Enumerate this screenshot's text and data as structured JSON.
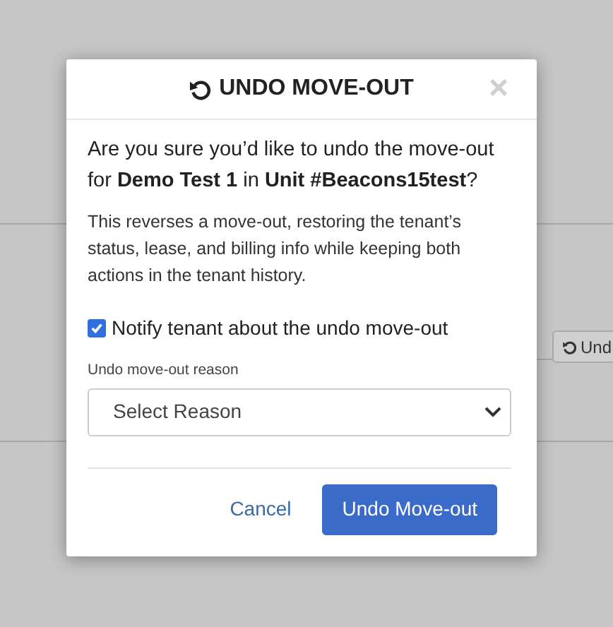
{
  "background": {
    "button": {
      "label": "Und"
    }
  },
  "dialog": {
    "title": "UNDO MOVE-OUT",
    "close": "×",
    "question": "Are you sure you’d like to undo the move-out for **Demo Test 1** in **Unit #Beacons15test**?",
    "description": "This reverses a move-out, restoring the tenant’s status, lease, and billing info while keeping both actions in the tenant history.",
    "notify": {
      "label": "Notify tenant about the undo move-out",
      "checked": true
    },
    "reason": {
      "label": "Undo move-out reason",
      "placeholder": "Select Reason"
    },
    "buttons": [
      {
        "kind": "link",
        "label": "Cancel"
      },
      {
        "kind": "primary",
        "label": "Undo Move-out"
      }
    ]
  }
}
